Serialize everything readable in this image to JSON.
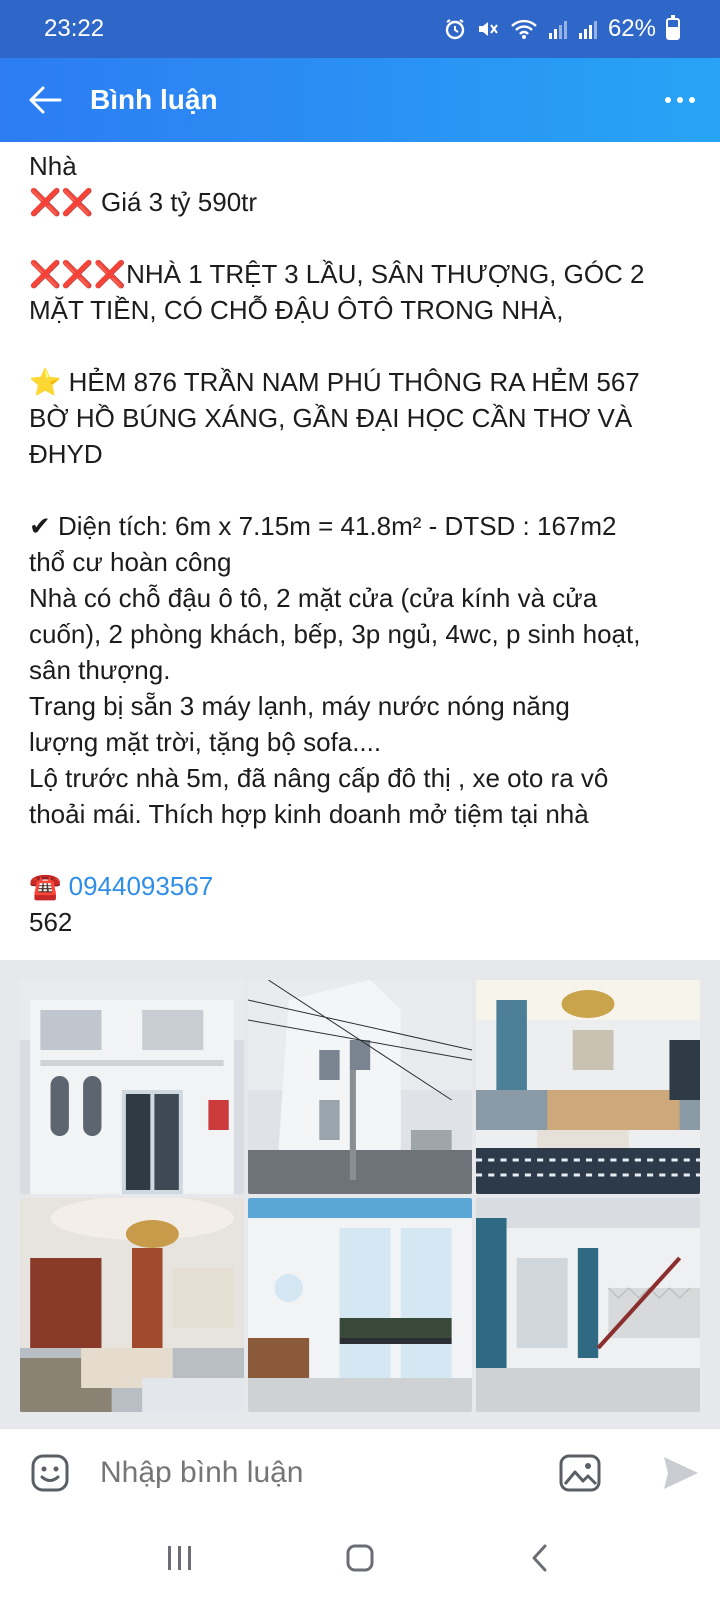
{
  "status_bar": {
    "time": "23:22",
    "battery": "62%",
    "icons": [
      "alarm-icon",
      "mute-icon",
      "wifi-icon",
      "signal-icon",
      "signal-icon",
      "battery-icon"
    ]
  },
  "app_bar": {
    "title": "Bình luận",
    "back_icon": "back-arrow-icon",
    "more_icon": "more-icon"
  },
  "post": {
    "lines": [
      "Nhà",
      "❌❌ Giá 3 tỷ 590tr",
      "",
      "❌❌❌NHÀ 1 TRỆT 3 LẦU, SÂN THƯỢNG, GÓC 2",
      "MẶT TIỀN, CÓ CHỖ ĐẬU ÔTÔ TRONG NHÀ,",
      "",
      "⭐ HẺM 876 TRẦN NAM PHÚ THÔNG RA HẺM 567",
      "BỜ HỒ BÚNG XÁNG, GẦN ĐẠI HỌC CẦN THƠ VÀ",
      "ĐHYD",
      "",
      "✔ Diện tích: 6m x 7.15m = 41.8m² - DTSD : 167m2",
      "thổ cư hoàn công",
      "Nhà có chỗ đậu ô tô, 2 mặt cửa (cửa kính và cửa",
      "cuốn), 2 phòng khách, bếp, 3p ngủ, 4wc, p sinh hoạt,",
      "sân thượng.",
      "Trang bị sẵn 3 máy lạnh, máy nước nóng năng",
      "lượng mặt trời, tặng bộ sofa....",
      "Lộ trước nhà 5m, đã nâng cấp đô thị , xe oto ra vô",
      "thoải mái. Thích hợp kinh doanh mở tiệm tại nhà",
      ""
    ],
    "phone_icon": "☎️",
    "phone": "0944093567",
    "after_phone": "562"
  },
  "photos": [
    {
      "name": "photo-house-facade"
    },
    {
      "name": "photo-corner-street"
    },
    {
      "name": "photo-living-room"
    },
    {
      "name": "photo-kitchen-chandelier"
    },
    {
      "name": "photo-balcony-room"
    },
    {
      "name": "photo-stairs-room"
    }
  ],
  "comment_bar": {
    "placeholder": "Nhập bình luận",
    "emoji_icon": "emoji-icon",
    "image_icon": "image-icon",
    "send_icon": "send-icon"
  },
  "nav_bar": {
    "icons": [
      "recent-apps-icon",
      "home-icon",
      "back-icon"
    ]
  },
  "colors": {
    "status_bar": "#2f67c8",
    "app_bar_start": "#2d7cf2",
    "app_bar_end": "#27a4f5",
    "link": "#2f8ee8",
    "photo_bg": "#e6e8eb"
  }
}
